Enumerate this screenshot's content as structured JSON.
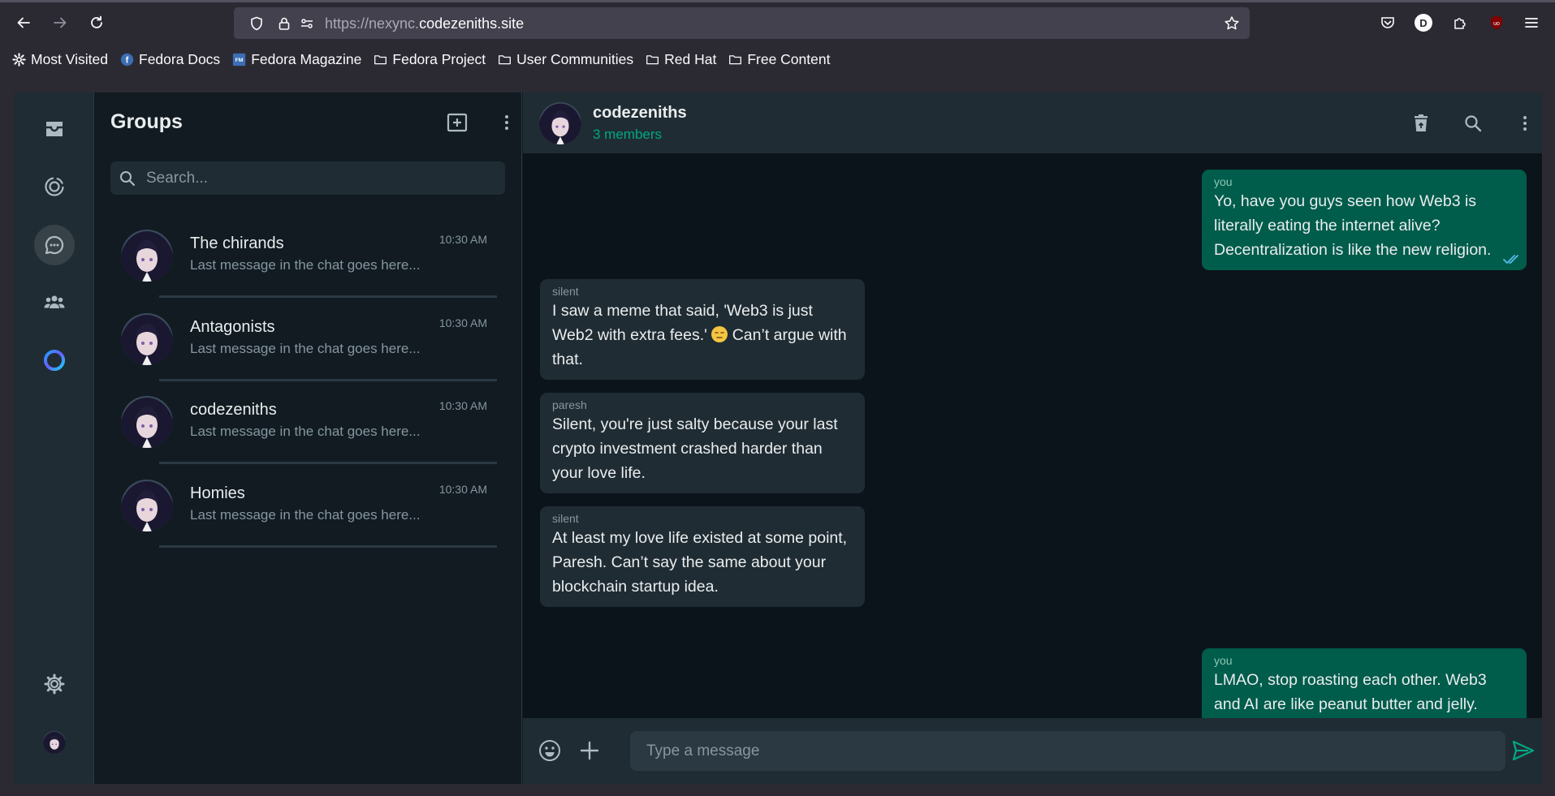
{
  "browser": {
    "url_prefix": "https://nexync.",
    "url_host": "codezeniths.site",
    "profile_initial": "D",
    "bookmarks": [
      {
        "label": "Most Visited",
        "icon": "gear-icon"
      },
      {
        "label": "Fedora Docs",
        "icon": "fedora-icon"
      },
      {
        "label": "Fedora Magazine",
        "icon": "fedora-magazine-icon"
      },
      {
        "label": "Fedora Project",
        "icon": "folder-icon"
      },
      {
        "label": "User Communities",
        "icon": "folder-icon"
      },
      {
        "label": "Red Hat",
        "icon": "folder-icon"
      },
      {
        "label": "Free Content",
        "icon": "folder-icon"
      }
    ]
  },
  "sidebar": {
    "title": "Groups",
    "search_placeholder": "Search...",
    "chats": [
      {
        "name": "The chirands",
        "last": "Last message in the chat goes here...",
        "time": "10:30 AM"
      },
      {
        "name": "Antagonists",
        "last": "Last message in the chat goes here...",
        "time": "10:30 AM"
      },
      {
        "name": "codezeniths",
        "last": "Last message in the chat goes here...",
        "time": "10:30 AM"
      },
      {
        "name": "Homies",
        "last": "Last message in the chat goes here...",
        "time": "10:30 AM"
      }
    ]
  },
  "chat": {
    "title": "codezeniths",
    "subtitle": "3 members",
    "messages": [
      {
        "sender": "you",
        "direction": "out",
        "text": "Yo, have you guys seen how Web3 is literally eating the internet alive? Decentralization is like the new religion."
      },
      {
        "sender": "silent",
        "direction": "in",
        "text_before": "I saw a meme that said, 'Web3 is just Web2 with extra fees.'",
        "emoji": "unamused-face",
        "text_after": " Can’t argue with that."
      },
      {
        "sender": "paresh",
        "direction": "in",
        "text": "Silent, you're just salty because your last crypto investment crashed harder than your love life."
      },
      {
        "sender": "silent",
        "direction": "in",
        "text": "At least my love life existed at some point, Paresh. Can’t say the same about your blockchain startup idea."
      },
      {
        "sender": "you",
        "direction": "out",
        "text": "LMAO, stop roasting each other. Web3 and AI are like peanut butter and jelly."
      }
    ],
    "input_placeholder": "Type a message"
  },
  "colors": {
    "accent": "#00a884",
    "outgoing_bubble": "#005c4b",
    "incoming_bubble": "#202c33"
  }
}
